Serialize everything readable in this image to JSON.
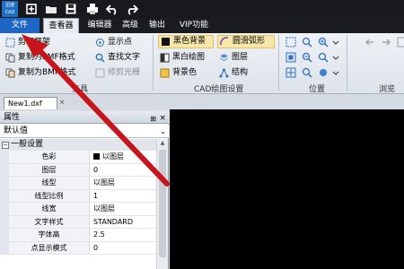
{
  "titlebar": {
    "logo_top": "迅捷",
    "logo_bottom": "CAD",
    "quick_icons": [
      "new-icon",
      "open-icon",
      "save-icon",
      "print-icon",
      "undo-icon",
      "redo-icon"
    ]
  },
  "menu": {
    "file": "文件",
    "viewer": "查看器",
    "editor": "编辑器",
    "advanced": "高级",
    "output": "输出",
    "vip": "VIP功能"
  },
  "ribbon": {
    "tools": {
      "clip_frame": "剪切框架",
      "copy_emf": "复制为EMF格式",
      "copy_bmp": "复制为BMP格式",
      "show_points": "显示点",
      "find_text": "查找文字",
      "trim_raster": "修剪光栅",
      "label": "工具"
    },
    "cad_settings": {
      "black_bg": "黑色背景",
      "smooth_arc": "圆滑弧形",
      "bw_drawing": "黑白绘图",
      "layers": "图层",
      "bg_color": "背景色",
      "structure": "结构",
      "label": "CAD绘图设置"
    },
    "position": {
      "label": "位置"
    },
    "browse": {
      "label": "浏览"
    }
  },
  "doc_tab": {
    "name": "New1.dxf",
    "close": "×"
  },
  "properties": {
    "title": "属性",
    "pin": "⊞",
    "close": "×",
    "default_value": "默认值",
    "group": "一般设置",
    "rows": [
      {
        "key": "色彩",
        "value": "以图层"
      },
      {
        "key": "图层",
        "value": "0"
      },
      {
        "key": "线型",
        "value": "以图层"
      },
      {
        "key": "线型比例",
        "value": "1"
      },
      {
        "key": "线宽",
        "value": "以图层"
      },
      {
        "key": "文字样式",
        "value": "STANDARD"
      },
      {
        "key": "字体高",
        "value": "2.5"
      },
      {
        "key": "点显示模式",
        "value": "0"
      }
    ]
  },
  "colors": {
    "accent_blue": "#1e66c5",
    "annotation_arrow": "#c8151b",
    "highlight": "#f8e7ad"
  }
}
